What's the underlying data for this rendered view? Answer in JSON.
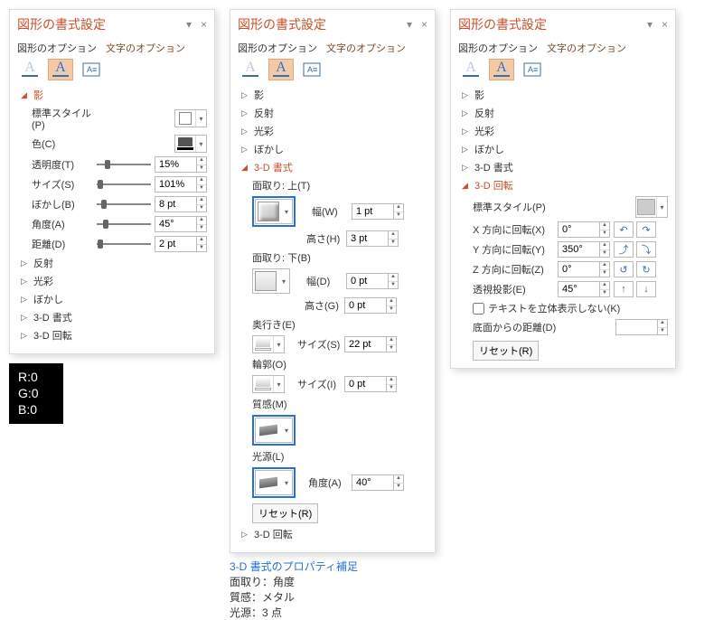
{
  "panel_title": "図形の書式設定",
  "tabs": {
    "shape_opt": "図形のオプション",
    "text_opt": "文字のオプション"
  },
  "pane_close": "×",
  "pane_menu": "▾",
  "sections": {
    "shadow": "影",
    "reflection": "反射",
    "glow": "光彩",
    "soft": "ぼかし",
    "fmt3d": "3-D 書式",
    "rot3d": "3-D 回転"
  },
  "left": {
    "preset_label": "標準スタイル(P)",
    "color_label": "色(C)",
    "transp_label": "透明度(T)",
    "transp_val": "15%",
    "size_label": "サイズ(S)",
    "size_val": "101%",
    "blur_label": "ぼかし(B)",
    "blur_val": "8 pt",
    "angle_label": "角度(A)",
    "angle_val": "45°",
    "dist_label": "距離(D)",
    "dist_val": "2 pt"
  },
  "mid": {
    "bevel_top": "面取り: 上(T)",
    "bevel_bot": "面取り: 下(B)",
    "width_w": "幅(W)",
    "width_w_val": "1 pt",
    "height_h": "高さ(H)",
    "height_h_val": "3 pt",
    "width_d": "幅(D)",
    "width_d_val": "0 pt",
    "height_g": "高さ(G)",
    "height_g_val": "0 pt",
    "depth": "奥行き(E)",
    "depth_size": "サイズ(S)",
    "depth_val": "22 pt",
    "contour": "輪郭(O)",
    "contour_size": "サイズ(I)",
    "contour_val": "0 pt",
    "material": "質感(M)",
    "lighting": "光源(L)",
    "angle_a": "角度(A)",
    "angle_a_val": "40°",
    "reset": "リセット(R)"
  },
  "right": {
    "preset_label": "標準スタイル(P)",
    "rotx": "X 方向に回転(X)",
    "rotx_val": "0°",
    "roty": "Y 方向に回転(Y)",
    "roty_val": "350°",
    "rotz": "Z 方向に回転(Z)",
    "rotz_val": "0°",
    "persp": "透視投影(E)",
    "persp_val": "45°",
    "flat_text": "テキストを立体表示しない(K)",
    "ground": "底面からの距離(D)",
    "reset": "リセット(R)"
  },
  "rgb": {
    "r": "R:0",
    "g": "G:0",
    "b": "B:0"
  },
  "caption": {
    "title": "3-D 書式のプロパティ補足",
    "l1": "面取り：角度",
    "l2": "質感：メタル",
    "l3": "光源：3 点"
  }
}
